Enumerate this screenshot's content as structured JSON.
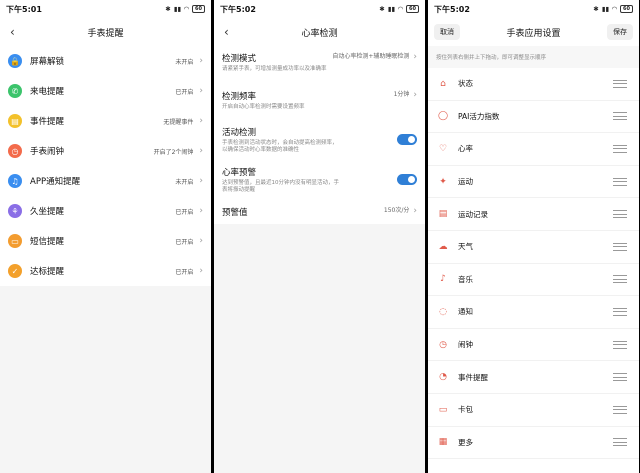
{
  "status": {
    "time1": "下午5:01",
    "time2": "下午5:02",
    "time3": "下午5:02",
    "battery": "60"
  },
  "screen1": {
    "title": "手表提醒",
    "items": [
      {
        "label": "屏幕解锁",
        "value": "未开启",
        "icon": "lock-icon",
        "color": "#3a8ef0"
      },
      {
        "label": "来电提醒",
        "value": "已开启",
        "icon": "phone-icon",
        "color": "#3cc46c"
      },
      {
        "label": "事件提醒",
        "value": "无提醒事件",
        "icon": "note-icon",
        "color": "#f3c12b"
      },
      {
        "label": "手表闹钟",
        "value": "开启了2个闹钟",
        "icon": "alarm-icon",
        "color": "#f36b4b"
      },
      {
        "label": "APP通知提醒",
        "value": "未开启",
        "icon": "bell-icon",
        "color": "#3a8ef0"
      },
      {
        "label": "久坐提醒",
        "value": "已开启",
        "icon": "sit-icon",
        "color": "#8a6ee6"
      },
      {
        "label": "短信提醒",
        "value": "已开启",
        "icon": "sms-icon",
        "color": "#f39c2f"
      },
      {
        "label": "达标提醒",
        "value": "已开启",
        "icon": "goal-icon",
        "color": "#f3a02b"
      }
    ]
  },
  "screen2": {
    "title": "心率检测",
    "sections": [
      {
        "title": "检测模式",
        "desc": "请紧紧手表，可增加测量成功率以及准确率",
        "value": "自动心率检测+辅助睡眠检测",
        "type": "chevron"
      },
      {
        "title": "检测频率",
        "desc": "开启自动心率检测时需要设置频率",
        "value": "1分钟",
        "type": "chevron"
      },
      {
        "title": "活动检测",
        "desc": "手表检测到活动状态时，会自动提高检测频率，以确保活动时心率数据的准确性",
        "value": "",
        "type": "toggle"
      },
      {
        "title": "心率预警",
        "desc": "达到预警值，且最近10分钟内没有明显活动，手表将振动提醒",
        "value": "",
        "type": "toggle"
      },
      {
        "title": "预警值",
        "desc": "",
        "value": "150次/分",
        "type": "chevron"
      }
    ]
  },
  "screen3": {
    "title": "手表应用设置",
    "cancel": "取消",
    "save": "保存",
    "hint": "按住列表右侧并上下拖动，即可调整显示顺序",
    "items": [
      {
        "label": "状态",
        "icon": "home-icon",
        "glyph": "⌂"
      },
      {
        "label": "PAI活力指数",
        "icon": "pai-icon",
        "glyph": "◯"
      },
      {
        "label": "心率",
        "icon": "heart-icon",
        "glyph": "♡"
      },
      {
        "label": "运动",
        "icon": "run-icon",
        "glyph": "✦"
      },
      {
        "label": "运动记录",
        "icon": "record-icon",
        "glyph": "▤"
      },
      {
        "label": "天气",
        "icon": "weather-icon",
        "glyph": "☁"
      },
      {
        "label": "音乐",
        "icon": "music-icon",
        "glyph": "♪"
      },
      {
        "label": "通知",
        "icon": "notify-icon",
        "glyph": "◌"
      },
      {
        "label": "闹钟",
        "icon": "alarm-icon",
        "glyph": "◷"
      },
      {
        "label": "事件提醒",
        "icon": "event-icon",
        "glyph": "◔"
      },
      {
        "label": "卡包",
        "icon": "card-icon",
        "glyph": "▭"
      },
      {
        "label": "更多",
        "icon": "more-icon",
        "glyph": "▦"
      }
    ]
  }
}
